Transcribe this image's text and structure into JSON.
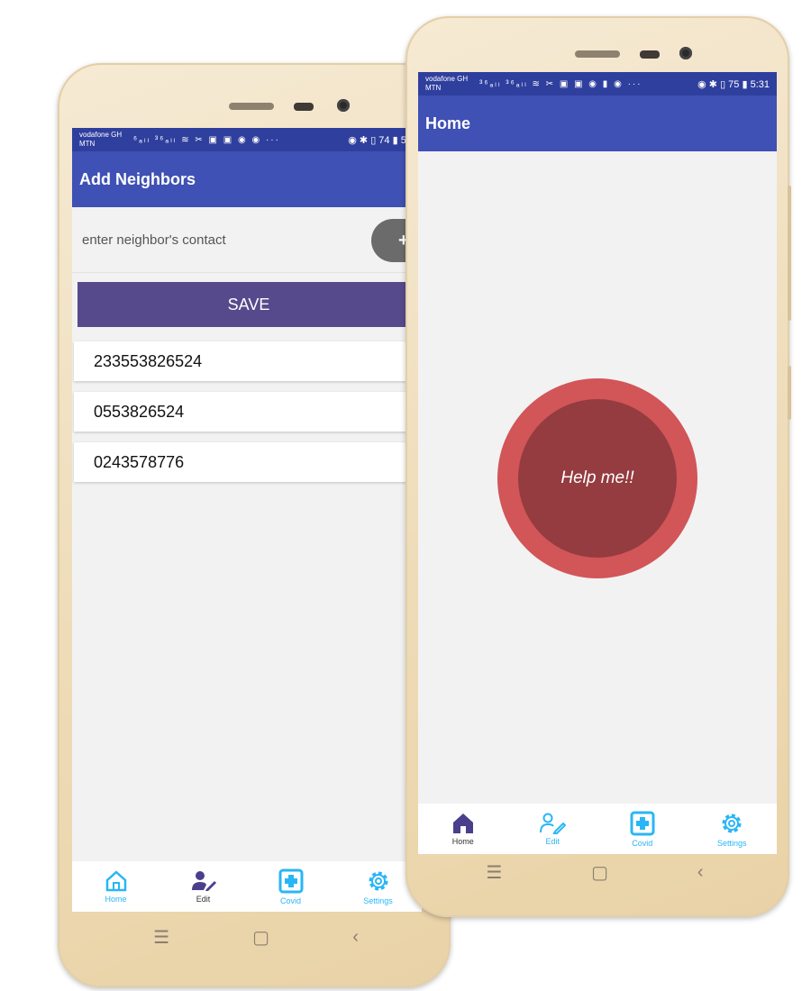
{
  "left_phone": {
    "status": {
      "carrier_line1": "vodafone GH",
      "carrier_line2": "MTN",
      "icons": "⁶ₐₗₗ ³⁶ₐₗₗ ≋ ✂ ▣ ▣ ◉ ◉ ···",
      "right": "◉ ✱ ▯ 74 ▮ 5:5"
    },
    "title": "Add Neighbors",
    "input": {
      "placeholder": "enter neighbor's contact"
    },
    "add_label": "+",
    "save_label": "SAVE",
    "contacts": [
      "233553826524",
      "0553826524",
      "0243578776"
    ],
    "delete_glyph": "✖",
    "nav": [
      {
        "label": "Home"
      },
      {
        "label": "Edit"
      },
      {
        "label": "Covid"
      },
      {
        "label": "Settings"
      }
    ]
  },
  "right_phone": {
    "status": {
      "carrier_line1": "vodafone GH",
      "carrier_line2": "MTN",
      "icons": "³⁶ₐₗₗ ³⁶ₐₗₗ ≋ ✂ ▣ ▣ ◉ ▮ ◉ ···",
      "right": "◉ ✱ ▯ 75 ▮ 5:31"
    },
    "title": "Home",
    "help_label": "Help me!!",
    "nav": [
      {
        "label": "Home"
      },
      {
        "label": "Edit"
      },
      {
        "label": "Covid"
      },
      {
        "label": "Settings"
      }
    ]
  },
  "hardware_nav": {
    "menu": "☰",
    "home": "▢",
    "back": "‹"
  },
  "colors": {
    "statusbar": "#2f3f9e",
    "appbar": "#3f51b5",
    "save_button": "#564a8c",
    "help_outer": "#d25558",
    "help_inner": "#943c40",
    "nav_active": "#29b6f6",
    "nav_dark": "#4a3f8c",
    "delete": "#e01616"
  }
}
